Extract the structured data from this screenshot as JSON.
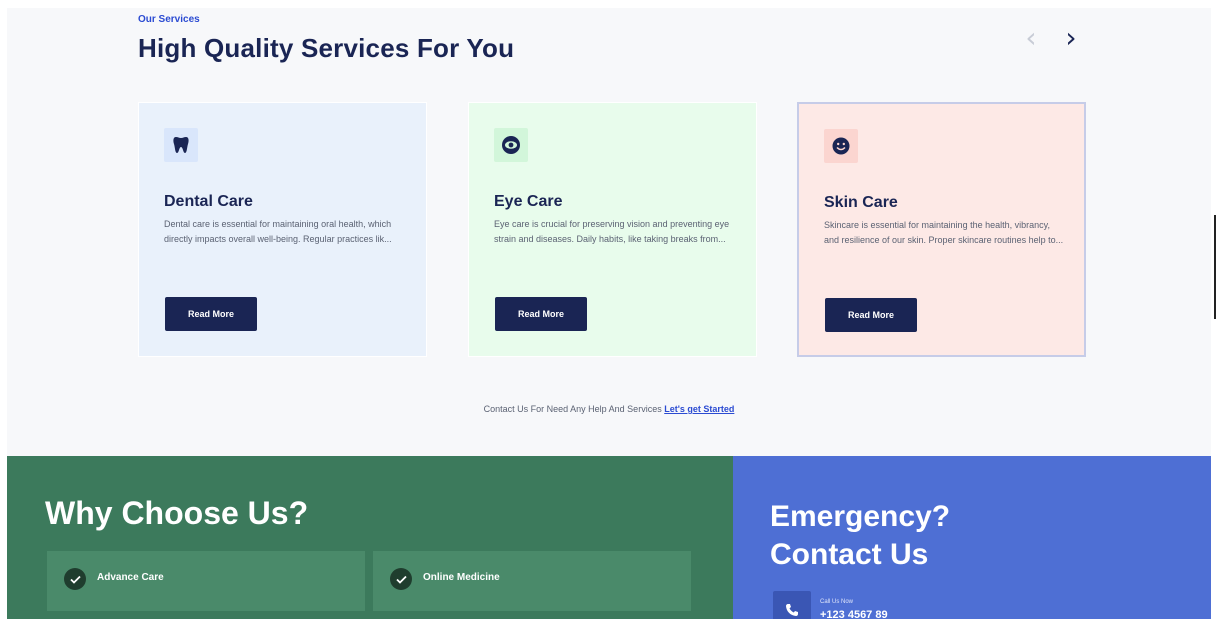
{
  "services": {
    "eyebrow": "Our Services",
    "title": "High Quality Services For You",
    "prev_icon": "chevron-left-icon",
    "next_icon": "chevron-right-icon",
    "cards": [
      {
        "title": "Dental Care",
        "description": "Dental care is essential for maintaining oral health, which directly impacts overall well-being. Regular practices lik...",
        "button": "Read More",
        "icon": "tooth-icon",
        "bg_color": "#e9f1fb"
      },
      {
        "title": "Eye Care",
        "description": "Eye care is crucial for preserving vision and preventing eye strain and diseases. Daily habits, like taking breaks from...",
        "button": "Read More",
        "icon": "eye-icon",
        "bg_color": "#e8fcec"
      },
      {
        "title": "Skin Care",
        "description": "Skincare is essential for maintaining the health, vibrancy, and resilience of our skin. Proper skincare routines help to...",
        "button": "Read More",
        "icon": "smile-icon",
        "bg_color": "#fde9e6"
      }
    ],
    "contact_text": "Contact Us For Need Any Help And Services",
    "contact_link": "Let's get Started"
  },
  "why": {
    "title": "Why Choose Us?",
    "features": [
      {
        "label": "Advance Care",
        "icon": "check-circle-icon"
      },
      {
        "label": "Online Medicine",
        "icon": "check-circle-icon"
      }
    ],
    "bg_color": "#3c7a5c"
  },
  "emergency": {
    "title_line1": "Emergency?",
    "title_line2": "Contact Us",
    "call_label": "Call Us Now",
    "phone": "+123 4567 89",
    "icon": "phone-icon",
    "bg_color": "#4e6fd4"
  },
  "colors": {
    "navy": "#1a2554",
    "accent_blue": "#2b4bd2"
  }
}
